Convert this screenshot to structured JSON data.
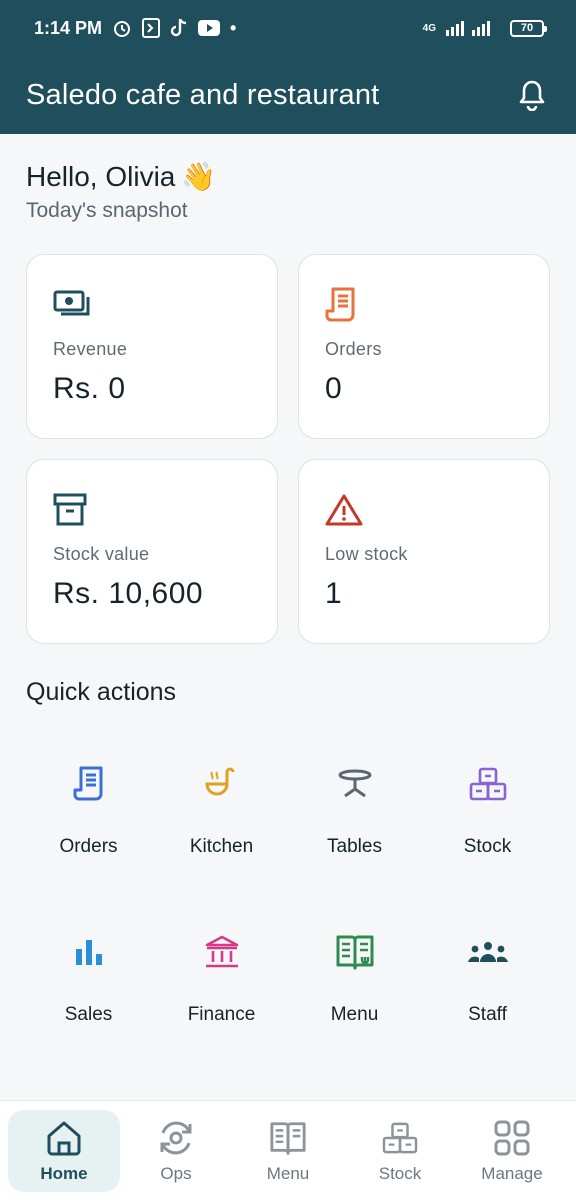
{
  "status_bar": {
    "time": "1:14 PM",
    "network": "4G",
    "battery": "70"
  },
  "header": {
    "title": "Saledo cafe and restaurant",
    "notification_icon": "bell-icon"
  },
  "greeting": {
    "hello": "Hello, Olivia",
    "emoji": "👋",
    "subtitle": "Today's snapshot"
  },
  "cards": [
    {
      "label": "Revenue",
      "value": "Rs. 0",
      "icon": "cash-icon",
      "color": "#1f4f5c"
    },
    {
      "label": "Orders",
      "value": "0",
      "icon": "receipt-icon",
      "color": "#e8733a"
    },
    {
      "label": "Stock value",
      "value": "Rs. 10,600",
      "icon": "archive-box-icon",
      "color": "#1f4f5c"
    },
    {
      "label": "Low stock",
      "value": "1",
      "icon": "warning-icon",
      "color": "#c0392b"
    }
  ],
  "quick_actions": {
    "title": "Quick actions",
    "items": [
      {
        "label": "Orders",
        "icon": "receipt-icon",
        "color": "#3b6fd6"
      },
      {
        "label": "Kitchen",
        "icon": "ladle-icon",
        "color": "#e1a021"
      },
      {
        "label": "Tables",
        "icon": "table-icon",
        "color": "#5a6670"
      },
      {
        "label": "Stock",
        "icon": "boxes-icon",
        "color": "#8a63d2"
      },
      {
        "label": "Sales",
        "icon": "bar-chart-icon",
        "color": "#2a8fd6"
      },
      {
        "label": "Finance",
        "icon": "bank-icon",
        "color": "#d63a86"
      },
      {
        "label": "Menu",
        "icon": "menu-book-icon",
        "color": "#2e8b4f"
      },
      {
        "label": "Staff",
        "icon": "staff-icon",
        "color": "#1f4f5c"
      }
    ]
  },
  "bottom_nav": [
    {
      "label": "Home",
      "icon": "home-icon",
      "active": true
    },
    {
      "label": "Ops",
      "icon": "ops-icon",
      "active": false
    },
    {
      "label": "Menu",
      "icon": "menu-book-icon",
      "active": false
    },
    {
      "label": "Stock",
      "icon": "boxes-icon",
      "active": false
    },
    {
      "label": "Manage",
      "icon": "grid-icon",
      "active": false
    }
  ]
}
